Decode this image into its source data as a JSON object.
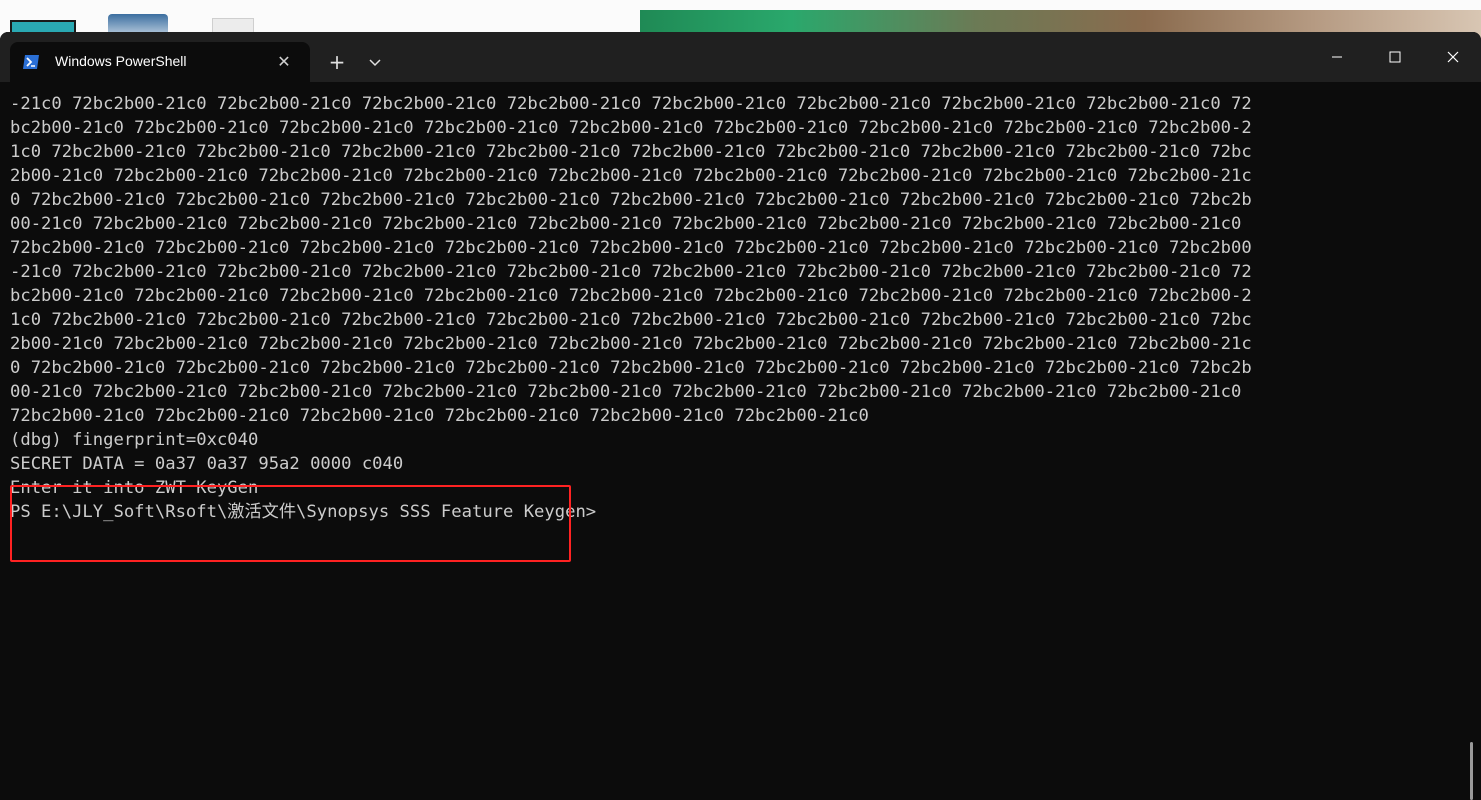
{
  "window": {
    "tab_title": "Windows PowerShell",
    "tab_close_glyph": "✕",
    "newtab_glyph": "+",
    "icons": [
      "powershell-icon",
      "close-icon",
      "plus-icon",
      "chevron-down-icon",
      "minimize-icon",
      "maximize-icon",
      "close-icon"
    ]
  },
  "terminal": {
    "output_lines": [
      "-21c0 72bc2b00-21c0 72bc2b00-21c0 72bc2b00-21c0 72bc2b00-21c0 72bc2b00-21c0 72bc2b00-21c0 72bc2b00-21c0 72bc2b00-21c0 72",
      "bc2b00-21c0 72bc2b00-21c0 72bc2b00-21c0 72bc2b00-21c0 72bc2b00-21c0 72bc2b00-21c0 72bc2b00-21c0 72bc2b00-21c0 72bc2b00-2",
      "1c0 72bc2b00-21c0 72bc2b00-21c0 72bc2b00-21c0 72bc2b00-21c0 72bc2b00-21c0 72bc2b00-21c0 72bc2b00-21c0 72bc2b00-21c0 72bc",
      "2b00-21c0 72bc2b00-21c0 72bc2b00-21c0 72bc2b00-21c0 72bc2b00-21c0 72bc2b00-21c0 72bc2b00-21c0 72bc2b00-21c0 72bc2b00-21c",
      "0 72bc2b00-21c0 72bc2b00-21c0 72bc2b00-21c0 72bc2b00-21c0 72bc2b00-21c0 72bc2b00-21c0 72bc2b00-21c0 72bc2b00-21c0 72bc2b",
      "00-21c0 72bc2b00-21c0 72bc2b00-21c0 72bc2b00-21c0 72bc2b00-21c0 72bc2b00-21c0 72bc2b00-21c0 72bc2b00-21c0 72bc2b00-21c0",
      "72bc2b00-21c0 72bc2b00-21c0 72bc2b00-21c0 72bc2b00-21c0 72bc2b00-21c0 72bc2b00-21c0 72bc2b00-21c0 72bc2b00-21c0 72bc2b00",
      "-21c0 72bc2b00-21c0 72bc2b00-21c0 72bc2b00-21c0 72bc2b00-21c0 72bc2b00-21c0 72bc2b00-21c0 72bc2b00-21c0 72bc2b00-21c0 72",
      "bc2b00-21c0 72bc2b00-21c0 72bc2b00-21c0 72bc2b00-21c0 72bc2b00-21c0 72bc2b00-21c0 72bc2b00-21c0 72bc2b00-21c0 72bc2b00-2",
      "1c0 72bc2b00-21c0 72bc2b00-21c0 72bc2b00-21c0 72bc2b00-21c0 72bc2b00-21c0 72bc2b00-21c0 72bc2b00-21c0 72bc2b00-21c0 72bc",
      "2b00-21c0 72bc2b00-21c0 72bc2b00-21c0 72bc2b00-21c0 72bc2b00-21c0 72bc2b00-21c0 72bc2b00-21c0 72bc2b00-21c0 72bc2b00-21c",
      "0 72bc2b00-21c0 72bc2b00-21c0 72bc2b00-21c0 72bc2b00-21c0 72bc2b00-21c0 72bc2b00-21c0 72bc2b00-21c0 72bc2b00-21c0 72bc2b",
      "00-21c0 72bc2b00-21c0 72bc2b00-21c0 72bc2b00-21c0 72bc2b00-21c0 72bc2b00-21c0 72bc2b00-21c0 72bc2b00-21c0 72bc2b00-21c0",
      "72bc2b00-21c0 72bc2b00-21c0 72bc2b00-21c0 72bc2b00-21c0 72bc2b00-21c0 72bc2b00-21c0"
    ],
    "highlighted_lines": [
      "(dbg) fingerprint=0xc040",
      "SECRET DATA = 0a37 0a37 95a2 0000 c040",
      "Enter it into ZWT KeyGen"
    ],
    "prompt": "PS E:\\JLY_Soft\\Rsoft\\激活文件\\Synopsys SSS Feature Keygen>"
  }
}
